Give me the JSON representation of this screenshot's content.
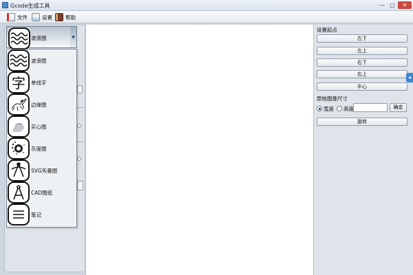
{
  "window": {
    "title": "Gcode生成工具",
    "controls": {
      "minimize": "—",
      "maximize": "□",
      "close": "✕"
    }
  },
  "toolbar": {
    "items": [
      {
        "label": "文件",
        "icon": "file-icon"
      },
      {
        "label": "设置",
        "icon": "settings-icon"
      },
      {
        "label": "帮助",
        "icon": "help-book-icon"
      }
    ]
  },
  "mode_selector": {
    "selected": {
      "label": "波浪图",
      "icon": "wave-icon"
    },
    "arrow": "▼",
    "options": [
      {
        "label": "波浪图",
        "icon": "wave-icon"
      },
      {
        "label": "单线字",
        "icon": "character-icon",
        "glyph": "字"
      },
      {
        "label": "边缘图",
        "icon": "edge-bird-icon"
      },
      {
        "label": "实心图",
        "icon": "solid-image-icon"
      },
      {
        "label": "灰度图",
        "icon": "grayscale-dots-icon"
      },
      {
        "label": "SVG矢量图",
        "icon": "svg-vector-icon"
      },
      {
        "label": "CAD图纸",
        "icon": "cad-compass-icon"
      },
      {
        "label": "笔记",
        "icon": "notes-lines-icon"
      }
    ]
  },
  "right_panel": {
    "origin_title": "设置起点",
    "origin_buttons": [
      "左下",
      "左上",
      "右下",
      "右上",
      "中心"
    ],
    "size_title": "原始图像尺寸",
    "width_label": "宽度",
    "height_label": "高度",
    "size_value": "",
    "width_selected": true,
    "confirm_label": "确定",
    "rotate_label": "旋转"
  },
  "colors": {
    "panel_bg": "#dfe4ea",
    "canvas_bg": "#ffffff",
    "close_button": "#c94a3f",
    "side_handle": "#3b86d6"
  }
}
